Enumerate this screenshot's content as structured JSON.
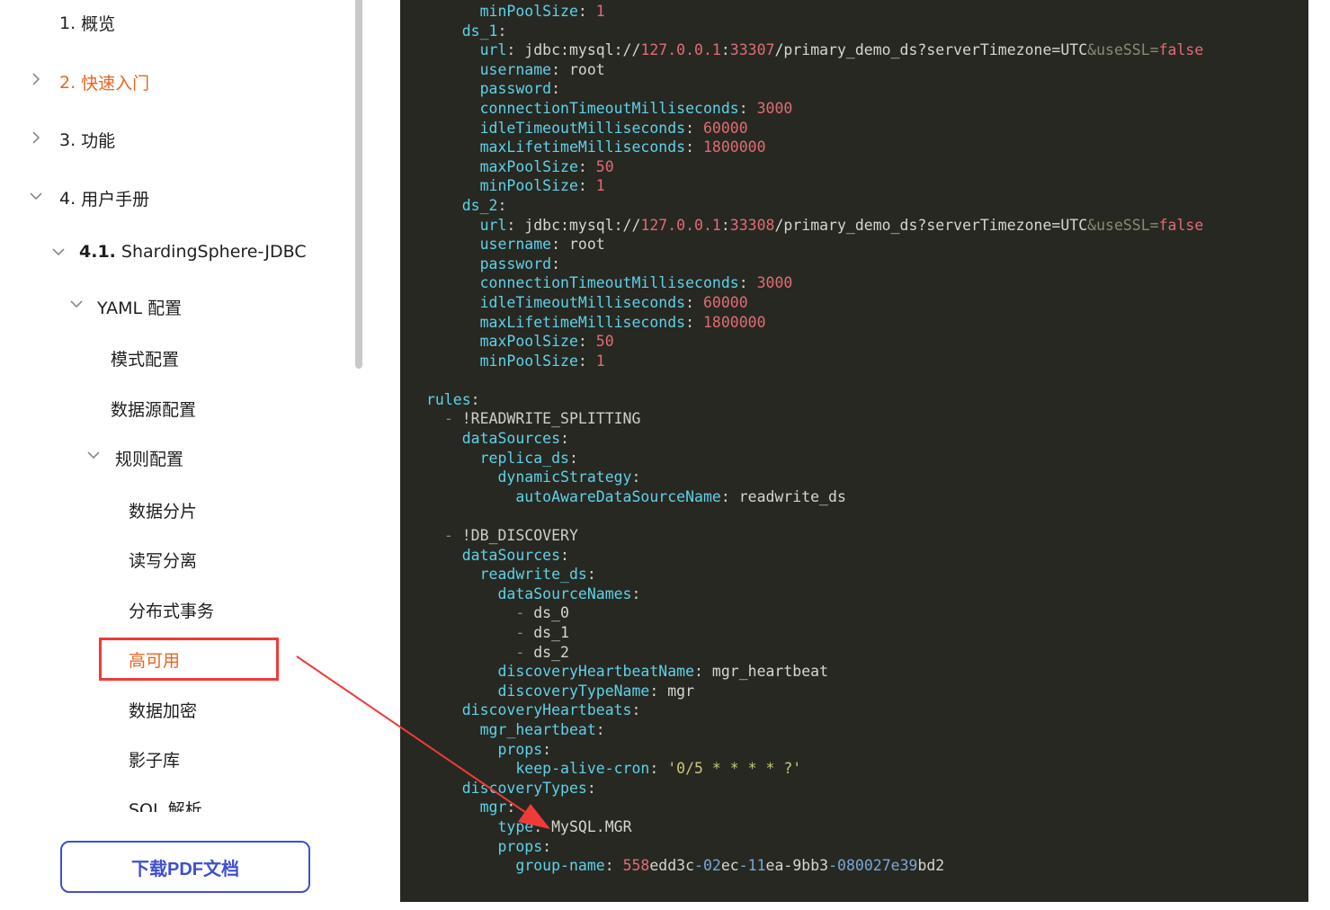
{
  "sidebar": {
    "items": [
      {
        "num": "1.",
        "label": "概览",
        "state": "none"
      },
      {
        "num": "2.",
        "label": "快速入门",
        "state": "collapsed",
        "active": true
      },
      {
        "num": "3.",
        "label": "功能",
        "state": "collapsed"
      },
      {
        "num": "4.",
        "label": "用户手册",
        "state": "expanded"
      },
      {
        "num": "4.1.",
        "label": "ShardingSphere-JDBC",
        "state": "expanded"
      },
      {
        "num": "",
        "label": "YAML 配置",
        "state": "expanded"
      },
      {
        "num": "",
        "label": "模式配置",
        "state": "none"
      },
      {
        "num": "",
        "label": "数据源配置",
        "state": "none"
      },
      {
        "num": "",
        "label": "规则配置",
        "state": "expanded"
      },
      {
        "num": "",
        "label": "数据分片",
        "state": "none"
      },
      {
        "num": "",
        "label": "读写分离",
        "state": "none"
      },
      {
        "num": "",
        "label": "分布式事务",
        "state": "none"
      },
      {
        "num": "",
        "label": "高可用",
        "state": "none",
        "active": true,
        "highlighted": true
      },
      {
        "num": "",
        "label": "数据加密",
        "state": "none"
      },
      {
        "num": "",
        "label": "影子库",
        "state": "none"
      },
      {
        "num": "",
        "label": "SQL 解析",
        "state": "none"
      }
    ],
    "download_button": "下载PDF文档"
  },
  "code": {
    "language": "yaml",
    "lines": [
      [
        [
          "      ",
          "p"
        ],
        [
          "minPoolSize",
          "k"
        ],
        [
          ": ",
          "p"
        ],
        [
          "1",
          "n"
        ]
      ],
      [
        [
          "    ",
          "p"
        ],
        [
          "ds_1",
          "k"
        ],
        [
          ":",
          "p"
        ]
      ],
      [
        [
          "      ",
          "p"
        ],
        [
          "url",
          "k"
        ],
        [
          ": jdbc:mysql://",
          "p"
        ],
        [
          "127.0.0.1",
          "n"
        ],
        [
          ":",
          "p"
        ],
        [
          "33307",
          "n"
        ],
        [
          "/primary_demo_ds?serverTimezone=UTC",
          "p"
        ],
        [
          "&useSSL=",
          "g"
        ],
        [
          "false",
          "n"
        ]
      ],
      [
        [
          "      ",
          "p"
        ],
        [
          "username",
          "k"
        ],
        [
          ": root",
          "p"
        ]
      ],
      [
        [
          "      ",
          "p"
        ],
        [
          "password",
          "k"
        ],
        [
          ":",
          "p"
        ]
      ],
      [
        [
          "      ",
          "p"
        ],
        [
          "connectionTimeoutMilliseconds",
          "k"
        ],
        [
          ": ",
          "p"
        ],
        [
          "3000",
          "n"
        ]
      ],
      [
        [
          "      ",
          "p"
        ],
        [
          "idleTimeoutMilliseconds",
          "k"
        ],
        [
          ": ",
          "p"
        ],
        [
          "60000",
          "n"
        ]
      ],
      [
        [
          "      ",
          "p"
        ],
        [
          "maxLifetimeMilliseconds",
          "k"
        ],
        [
          ": ",
          "p"
        ],
        [
          "1800000",
          "n"
        ]
      ],
      [
        [
          "      ",
          "p"
        ],
        [
          "maxPoolSize",
          "k"
        ],
        [
          ": ",
          "p"
        ],
        [
          "50",
          "n"
        ]
      ],
      [
        [
          "      ",
          "p"
        ],
        [
          "minPoolSize",
          "k"
        ],
        [
          ": ",
          "p"
        ],
        [
          "1",
          "n"
        ]
      ],
      [
        [
          "    ",
          "p"
        ],
        [
          "ds_2",
          "k"
        ],
        [
          ":",
          "p"
        ]
      ],
      [
        [
          "      ",
          "p"
        ],
        [
          "url",
          "k"
        ],
        [
          ": jdbc:mysql://",
          "p"
        ],
        [
          "127.0.0.1",
          "n"
        ],
        [
          ":",
          "p"
        ],
        [
          "33308",
          "n"
        ],
        [
          "/primary_demo_ds?serverTimezone=UTC",
          "p"
        ],
        [
          "&useSSL=",
          "g"
        ],
        [
          "false",
          "n"
        ]
      ],
      [
        [
          "      ",
          "p"
        ],
        [
          "username",
          "k"
        ],
        [
          ": root",
          "p"
        ]
      ],
      [
        [
          "      ",
          "p"
        ],
        [
          "password",
          "k"
        ],
        [
          ":",
          "p"
        ]
      ],
      [
        [
          "      ",
          "p"
        ],
        [
          "connectionTimeoutMilliseconds",
          "k"
        ],
        [
          ": ",
          "p"
        ],
        [
          "3000",
          "n"
        ]
      ],
      [
        [
          "      ",
          "p"
        ],
        [
          "idleTimeoutMilliseconds",
          "k"
        ],
        [
          ": ",
          "p"
        ],
        [
          "60000",
          "n"
        ]
      ],
      [
        [
          "      ",
          "p"
        ],
        [
          "maxLifetimeMilliseconds",
          "k"
        ],
        [
          ": ",
          "p"
        ],
        [
          "1800000",
          "n"
        ]
      ],
      [
        [
          "      ",
          "p"
        ],
        [
          "maxPoolSize",
          "k"
        ],
        [
          ": ",
          "p"
        ],
        [
          "50",
          "n"
        ]
      ],
      [
        [
          "      ",
          "p"
        ],
        [
          "minPoolSize",
          "k"
        ],
        [
          ": ",
          "p"
        ],
        [
          "1",
          "n"
        ]
      ],
      [
        [
          "",
          "p"
        ]
      ],
      [
        [
          "",
          "p"
        ],
        [
          "rules",
          "k"
        ],
        [
          ":",
          "p"
        ]
      ],
      [
        [
          "  ",
          "p"
        ],
        [
          "- ",
          "g"
        ],
        [
          "!READWRITE_SPLITTING",
          "t"
        ]
      ],
      [
        [
          "    ",
          "p"
        ],
        [
          "dataSources",
          "k"
        ],
        [
          ":",
          "p"
        ]
      ],
      [
        [
          "      ",
          "p"
        ],
        [
          "replica_ds",
          "k"
        ],
        [
          ":",
          "p"
        ]
      ],
      [
        [
          "        ",
          "p"
        ],
        [
          "dynamicStrategy",
          "k"
        ],
        [
          ":",
          "p"
        ]
      ],
      [
        [
          "          ",
          "p"
        ],
        [
          "autoAwareDataSourceName",
          "k"
        ],
        [
          ": readwrite_ds",
          "p"
        ]
      ],
      [
        [
          "",
          "p"
        ]
      ],
      [
        [
          "  ",
          "p"
        ],
        [
          "- ",
          "g"
        ],
        [
          "!DB_DISCOVERY",
          "t"
        ]
      ],
      [
        [
          "    ",
          "p"
        ],
        [
          "dataSources",
          "k"
        ],
        [
          ":",
          "p"
        ]
      ],
      [
        [
          "      ",
          "p"
        ],
        [
          "readwrite_ds",
          "k"
        ],
        [
          ":",
          "p"
        ]
      ],
      [
        [
          "        ",
          "p"
        ],
        [
          "dataSourceNames",
          "k"
        ],
        [
          ":",
          "p"
        ]
      ],
      [
        [
          "          ",
          "p"
        ],
        [
          "- ",
          "g"
        ],
        [
          "ds_0",
          "p"
        ]
      ],
      [
        [
          "          ",
          "p"
        ],
        [
          "- ",
          "g"
        ],
        [
          "ds_1",
          "p"
        ]
      ],
      [
        [
          "          ",
          "p"
        ],
        [
          "- ",
          "g"
        ],
        [
          "ds_2",
          "p"
        ]
      ],
      [
        [
          "        ",
          "p"
        ],
        [
          "discoveryHeartbeatName",
          "k"
        ],
        [
          ": mgr_heartbeat",
          "p"
        ]
      ],
      [
        [
          "        ",
          "p"
        ],
        [
          "discoveryTypeName",
          "k"
        ],
        [
          ": mgr",
          "p"
        ]
      ],
      [
        [
          "    ",
          "p"
        ],
        [
          "discoveryHeartbeats",
          "k"
        ],
        [
          ":",
          "p"
        ]
      ],
      [
        [
          "      ",
          "p"
        ],
        [
          "mgr_heartbeat",
          "k"
        ],
        [
          ":",
          "p"
        ]
      ],
      [
        [
          "        ",
          "p"
        ],
        [
          "props",
          "k"
        ],
        [
          ":",
          "p"
        ]
      ],
      [
        [
          "          ",
          "p"
        ],
        [
          "keep-alive-cron",
          "k"
        ],
        [
          ": ",
          "p"
        ],
        [
          "'0/5 * * * * ?'",
          "s"
        ]
      ],
      [
        [
          "    ",
          "p"
        ],
        [
          "discoveryTypes",
          "k"
        ],
        [
          ":",
          "p"
        ]
      ],
      [
        [
          "      ",
          "p"
        ],
        [
          "mgr",
          "k"
        ],
        [
          ":",
          "p"
        ]
      ],
      [
        [
          "        ",
          "p"
        ],
        [
          "type",
          "k"
        ],
        [
          ": MySQL.MGR",
          "p"
        ]
      ],
      [
        [
          "        ",
          "p"
        ],
        [
          "props",
          "k"
        ],
        [
          ":",
          "p"
        ]
      ],
      [
        [
          "          ",
          "p"
        ],
        [
          "group-name",
          "k"
        ],
        [
          ": ",
          "p"
        ],
        [
          "558",
          "n"
        ],
        [
          "edd3c",
          "p"
        ],
        [
          "-02",
          "b"
        ],
        [
          "ec",
          "p"
        ],
        [
          "-11",
          "b"
        ],
        [
          "ea-9bb3",
          "p"
        ],
        [
          "-080027e39",
          "b"
        ],
        [
          "bd2",
          "p"
        ]
      ]
    ]
  },
  "colors": {
    "accent_active": "#e8651f",
    "highlight_box": "#f03a3a",
    "button_border": "#3e4fcf",
    "code_background": "#272822",
    "code_key": "#5fd1e8",
    "code_number": "#e06c75",
    "arrow": "#f03a3a"
  }
}
